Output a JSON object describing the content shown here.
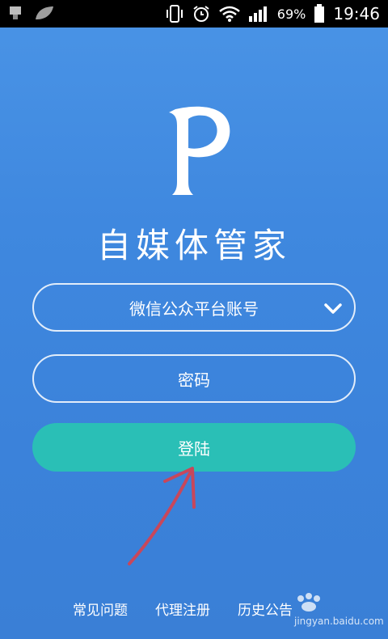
{
  "status_bar": {
    "battery_percent": "69%",
    "time": "19:46"
  },
  "logo": {
    "letter": "P"
  },
  "app_title": "自媒体管家",
  "account_field": {
    "value": "微信公众平台账号"
  },
  "password_field": {
    "placeholder": "密码"
  },
  "login_button": {
    "label": "登陆"
  },
  "footer": {
    "links": [
      "常见问题",
      "代理注册",
      "历史公告"
    ]
  },
  "watermark": {
    "text": "jingyan.baidu.com"
  },
  "colors": {
    "background": "#3f88df",
    "login_button": "#2abfb6",
    "annotation_arrow": "#c8475b"
  }
}
